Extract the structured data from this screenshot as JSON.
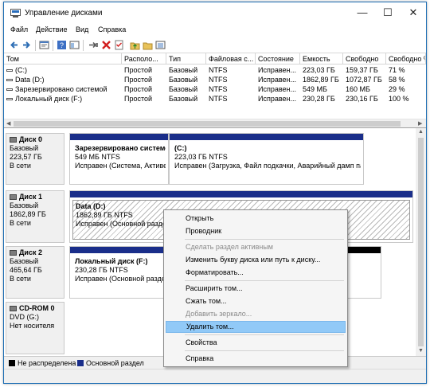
{
  "window": {
    "title": "Управление дисками"
  },
  "window_controls": {
    "minimize": "—",
    "maximize": "☐",
    "close": "✕"
  },
  "menu": [
    "Файл",
    "Действие",
    "Вид",
    "Справка"
  ],
  "toolbar": [
    "back-icon",
    "forward-icon",
    "properties-icon",
    "help-icon",
    "console-icon",
    "connect-icon",
    "delete-icon",
    "checklist-icon",
    "folder-up-icon",
    "folder-icon",
    "view-icon"
  ],
  "volume_table": {
    "columns": [
      "Том",
      "Располо...",
      "Тип",
      "Файловая с...",
      "Состояние",
      "Емкость",
      "Свободно",
      "Свободно %"
    ],
    "rows": [
      [
        "(C:)",
        "Простой",
        "Базовый",
        "NTFS",
        "Исправен...",
        "223,03 ГБ",
        "159,37 ГБ",
        "71 %"
      ],
      [
        "Data (D:)",
        "Простой",
        "Базовый",
        "NTFS",
        "Исправен...",
        "1862,89 ГБ",
        "1072,87 ГБ",
        "58 %"
      ],
      [
        "Зарезервировано системой",
        "Простой",
        "Базовый",
        "NTFS",
        "Исправен...",
        "549 МБ",
        "160 МБ",
        "29 %"
      ],
      [
        "Локальный диск (F:)",
        "Простой",
        "Базовый",
        "NTFS",
        "Исправен...",
        "230,28 ГБ",
        "230,16 ГБ",
        "100 %"
      ]
    ]
  },
  "disks": [
    {
      "name": "Диск 0",
      "type": "Базовый",
      "size": "223,57 ГБ",
      "status": "В сети",
      "partitions": [
        {
          "name": "Зарезервировано системой",
          "size": "549 МБ NTFS",
          "status": "Исправен (Система, Активен"
        },
        {
          "name": "(C:)",
          "size": "223,03 ГБ NTFS",
          "status": "Исправен (Загрузка, Файл подкачки, Аварийный дамп пам"
        }
      ]
    },
    {
      "name": "Диск 1",
      "type": "Базовый",
      "size": "1862,89 ГБ",
      "status": "В сети",
      "partitions": [
        {
          "name": "Data  (D:)",
          "size": "1862,89 ГБ NTFS",
          "status": "Исправен (Основной раздел"
        }
      ]
    },
    {
      "name": "Диск 2",
      "type": "Базовый",
      "size": "465,64 ГБ",
      "status": "В сети",
      "partitions": [
        {
          "name": "Локальный диск  (F:)",
          "size": "230,28 ГБ NTFS",
          "status": "Исправен (Основной раздел"
        }
      ]
    },
    {
      "name": "CD-ROM 0",
      "type": "DVD (G:)",
      "size": "",
      "status": "Нет носителя",
      "partitions": []
    }
  ],
  "legend": [
    {
      "label": "Не распределена",
      "color": "#000000"
    },
    {
      "label": "Основной раздел",
      "color": "#1a2e8a"
    }
  ],
  "context_menu": {
    "items": [
      {
        "label": "Открыть",
        "disabled": false
      },
      {
        "label": "Проводник",
        "disabled": false
      },
      {
        "label": "Сделать раздел активным",
        "disabled": true
      },
      {
        "label": "Изменить букву диска или путь к диску...",
        "disabled": false
      },
      {
        "label": "Форматировать...",
        "disabled": false
      },
      {
        "label": "Расширить том...",
        "disabled": false
      },
      {
        "label": "Сжать том...",
        "disabled": false
      },
      {
        "label": "Добавить зеркало...",
        "disabled": true
      },
      {
        "label": "Удалить том...",
        "disabled": false,
        "highlighted": true
      },
      {
        "label": "Свойства",
        "disabled": false
      },
      {
        "label": "Справка",
        "disabled": false
      }
    ]
  }
}
